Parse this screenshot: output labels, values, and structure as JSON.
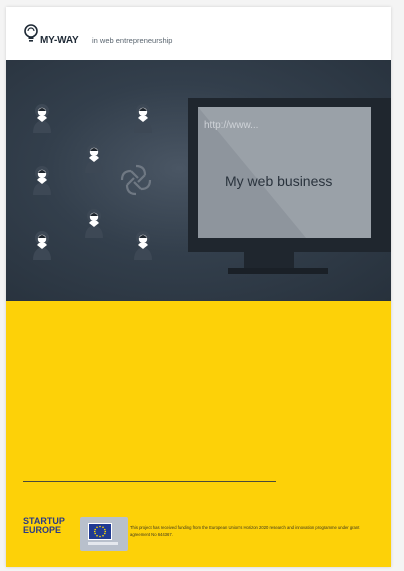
{
  "header": {
    "brand": "MY-WAY",
    "tagline": "in web entrepreneurship"
  },
  "hero": {
    "url": "http://www...",
    "screen_title": "My web business"
  },
  "footer": {
    "logo_line1": "STARTUP",
    "logo_line2": "EUROPE",
    "funding_text": "This project has received funding from the European Union's Horizon 2020 research and innovation programme under grant agreement No 644367."
  },
  "colors": {
    "hero_bg": "#333f4c",
    "yellow": "#fdd108",
    "brand_text": "#1f2a36",
    "startup_blue": "#2c3b86",
    "eu_blue": "#1f3a93"
  },
  "icons": [
    "lightbulb-logo-icon",
    "person-icon",
    "monitor-icon",
    "pinwheel-icon",
    "eu-flag-icon"
  ]
}
